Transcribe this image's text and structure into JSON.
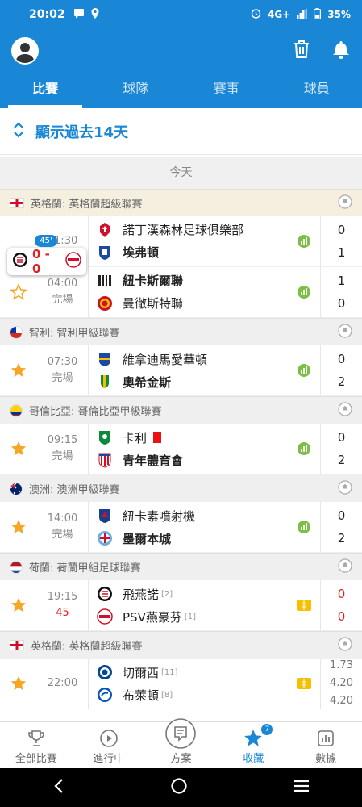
{
  "status": {
    "time": "20:02",
    "net": "4G+",
    "battery": "35%"
  },
  "tabs": [
    "比賽",
    "球隊",
    "賽事",
    "球員"
  ],
  "show_past": "顯示過去14天",
  "day": "今天",
  "live_popup": {
    "minute": "45'",
    "score": "0 - 0"
  },
  "leagues": [
    {
      "name": "英格蘭: 英格蘭超級聯賽",
      "matches": [
        {
          "time": "01:30",
          "status": "",
          "home": "諾丁漢森林足球俱樂部",
          "away": "埃弗頓",
          "home_score": "0",
          "away_score": "1"
        },
        {
          "time": "04:00",
          "status": "完場",
          "home": "紐卡斯爾聯",
          "away": "曼徹斯特聯",
          "home_score": "1",
          "away_score": "0"
        }
      ]
    },
    {
      "name": "智利: 智利甲級聯賽",
      "matches": [
        {
          "time": "07:30",
          "status": "完場",
          "home": "維拿迪馬愛華頓",
          "away": "奧希金斯",
          "home_score": "0",
          "away_score": "2"
        }
      ]
    },
    {
      "name": "哥倫比亞: 哥倫比亞甲級聯賽",
      "matches": [
        {
          "time": "09:15",
          "status": "完場",
          "home": "卡利",
          "away": "青年體育會",
          "home_score": "0",
          "away_score": "2"
        }
      ]
    },
    {
      "name": "澳洲: 澳洲甲級聯賽",
      "matches": [
        {
          "time": "14:00",
          "status": "完場",
          "home": "紐卡素噴射機",
          "away": "墨爾本城",
          "home_score": "0",
          "away_score": "2"
        }
      ]
    },
    {
      "name": "荷蘭: 荷蘭甲組足球聯賽",
      "matches": [
        {
          "time": "19:15",
          "status": "45",
          "home": "飛燕諾",
          "home_rank": "[2]",
          "away": "PSV燕豪芬",
          "away_rank": "[1]",
          "home_score": "0",
          "away_score": "0"
        }
      ]
    },
    {
      "name": "英格蘭: 英格蘭超級聯賽",
      "matches": [
        {
          "time": "22:00",
          "status": "",
          "home": "切爾西",
          "home_rank": "[11]",
          "away": "布萊頓",
          "away_rank": "[8]",
          "odds": [
            "1.73",
            "4.20",
            "4.20"
          ]
        }
      ]
    }
  ],
  "bottom_nav": [
    "全部比賽",
    "進行中",
    "方案",
    "收藏",
    "數據"
  ],
  "fav_count": "7",
  "colors": {
    "primary": "#1a86d6",
    "star": "#f5a623",
    "live": "#dd2222"
  }
}
